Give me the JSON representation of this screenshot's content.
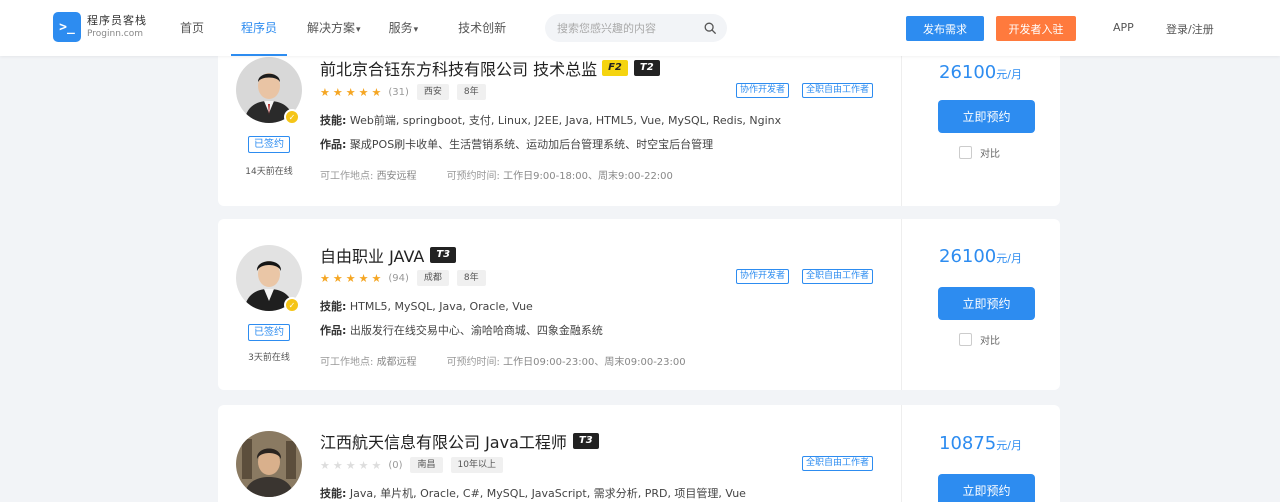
{
  "header": {
    "logo_cn": "程序员客栈",
    "logo_en": "Proginn.com",
    "nav": [
      "首页",
      "程序员",
      "解决方案",
      "服务",
      "技术创新"
    ],
    "search_placeholder": "搜索您感兴趣的内容",
    "publish_label": "发布需求",
    "join_label": "开发者入驻",
    "app_label": "APP",
    "login_label": "登录/注册"
  },
  "labels": {
    "skills": "技能:",
    "works": "作品:",
    "location_label": "可工作地点:",
    "time_label": "可预约时间:",
    "book": "立即预约",
    "compare": "对比",
    "signed": "已签约",
    "price_unit": "元/月"
  },
  "cards": [
    {
      "title": "前北京合钰东方科技有限公司 技术总监",
      "tag_f": "F2",
      "tag_t": "T2",
      "rating_count": "(31)",
      "city": "西安",
      "years": "8年",
      "type_tags": [
        "协作开发者",
        "全职自由工作者"
      ],
      "skills": "Web前端, springboot, 支付, Linux, J2EE, Java, HTML5, Vue, MySQL, Redis, Nginx",
      "works": "聚成POS刷卡收单、生活营销系统、运动加后台管理系统、时空宝后台管理",
      "location": "西安远程",
      "time_weekday": "工作日9:00-18:00",
      "time_weekend": "周末9:00-22:00",
      "online": "14天前在线",
      "price": "26100"
    },
    {
      "title": "自由职业 JAVA",
      "tag_t": "T3",
      "rating_count": "(94)",
      "city": "成都",
      "years": "8年",
      "type_tags": [
        "协作开发者",
        "全职自由工作者"
      ],
      "skills": "HTML5, MySQL, Java, Oracle, Vue",
      "works": "出版发行在线交易中心、渝哈哈商城、四象金融系统",
      "location": "成都远程",
      "time_weekday": "工作日09:00-23:00",
      "time_weekend": "周末09:00-23:00",
      "online": "3天前在线",
      "price": "26100"
    },
    {
      "title": "江西航天信息有限公司 Java工程师",
      "tag_t": "T3",
      "rating_count": "(0)",
      "city": "南昌",
      "years": "10年以上",
      "type_tags": [
        "全职自由工作者"
      ],
      "skills": "Java, 单片机, Oracle, C#, MySQL, JavaScript, 需求分析, PRD, 项目管理, Vue",
      "price": "10875"
    }
  ]
}
